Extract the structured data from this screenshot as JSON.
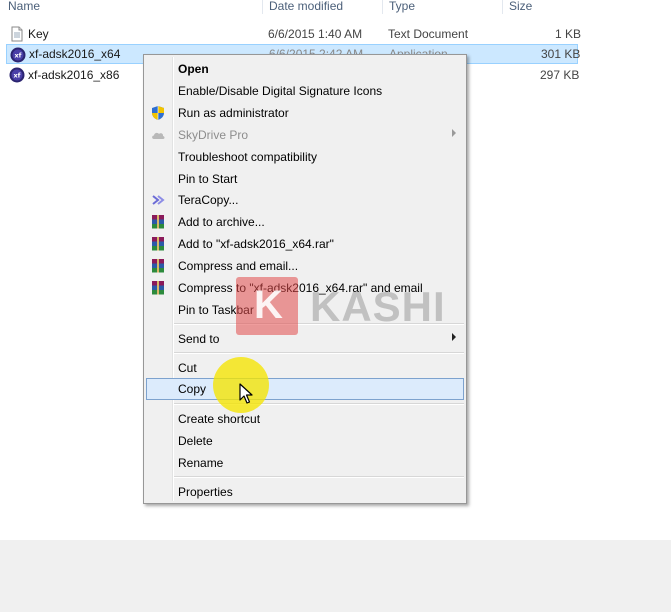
{
  "columns": {
    "name": "Name",
    "date_modified": "Date modified",
    "type": "Type",
    "size": "Size"
  },
  "files": [
    {
      "name": "Key",
      "date": "6/6/2015 1:40 AM",
      "type": "Text Document",
      "size": "1 KB",
      "icon": "text-document-icon"
    },
    {
      "name": "xf-adsk2016_x64",
      "date": "6/6/2015 2:42 AM",
      "type": "Application",
      "size": "301 KB",
      "icon": "xforce-app-icon",
      "selected": true
    },
    {
      "name": "xf-adsk2016_x86",
      "date": "",
      "type": "",
      "size": "297 KB",
      "icon": "xforce-app-icon"
    }
  ],
  "context_menu": {
    "items": [
      {
        "label": "Open"
      },
      {
        "label": "Enable/Disable Digital Signature Icons"
      },
      {
        "label": "Run as administrator",
        "icon": "uac-shield-icon"
      },
      {
        "label": "SkyDrive Pro",
        "icon": "skydrive-icon"
      },
      {
        "label": "Troubleshoot compatibility"
      },
      {
        "label": "Pin to Start"
      },
      {
        "label": "TeraCopy...",
        "icon": "teracopy-icon"
      },
      {
        "label": "Add to archive...",
        "icon": "winrar-icon"
      },
      {
        "label": "Add to \"xf-adsk2016_x64.rar\"",
        "icon": "winrar-icon"
      },
      {
        "label": "Compress and email...",
        "icon": "winrar-icon"
      },
      {
        "label": "Compress to \"xf-adsk2016_x64.rar\" and email",
        "icon": "winrar-icon"
      },
      {
        "label": "Pin to Taskbar"
      },
      {
        "label": "Send to"
      },
      {
        "label": "Cut"
      },
      {
        "label": "Copy"
      },
      {
        "label": "Create shortcut"
      },
      {
        "label": "Delete"
      },
      {
        "label": "Rename"
      },
      {
        "label": "Properties"
      }
    ]
  },
  "watermark": {
    "letter": "K",
    "text": "KASHI"
  },
  "colors": {
    "selection_fill": "#cce8ff",
    "menu_bg": "#f0f0f0",
    "highlight": "#dcebfc",
    "cursor_glow": "#f5e400"
  }
}
